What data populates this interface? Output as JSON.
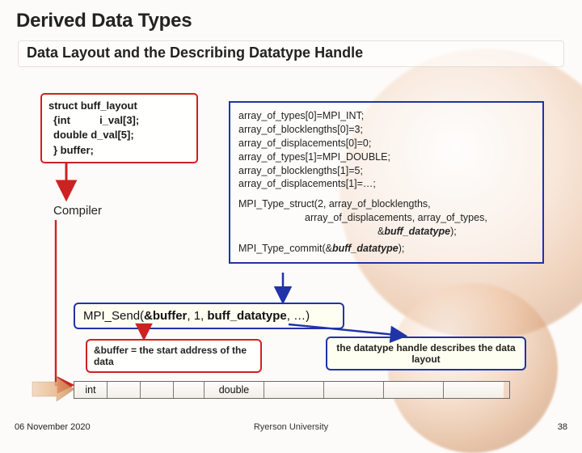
{
  "title": "Derived Data Types",
  "subtitle": "Data Layout and the Describing Datatype Handle",
  "struct": {
    "line1": "struct buff_layout",
    "line2_a": " {int",
    "line2_b": "i_val[3];",
    "line3": "  double d_val[5];",
    "line4": " } buffer;"
  },
  "compiler_label": "Compiler",
  "code": {
    "l1": "array_of_types[0]=MPI_INT;",
    "l2": "array_of_blocklengths[0]=3;",
    "l3": "array_of_displacements[0]=0;",
    "l4": "array_of_types[1]=MPI_DOUBLE;",
    "l5": "array_of_blocklengths[1]=5;",
    "l6": "array_of_displacements[1]=…;",
    "l7a": "MPI_Type_struct(2, array_of_blocklengths,",
    "l7b": "array_of_displacements, array_of_types,",
    "l7c_amp": "&",
    "l7c_arg": "buff_datatype",
    "l7c_tail": ");",
    "l8a": "MPI_Type_commit(&",
    "l8b": "buff_datatype",
    "l8c": ");"
  },
  "send": {
    "pre": "MPI_Send(",
    "arg1": "&buffer",
    "mid1": ", 1, ",
    "arg2": "buff_datatype",
    "tail": ", …)"
  },
  "buf_desc": "&buffer = the start address of the data",
  "handle_desc": "the datatype handle describes the data layout",
  "cells": {
    "int": "int",
    "double": "double"
  },
  "footer": {
    "date": "06 November 2020",
    "univ": "Ryerson University",
    "page": "38"
  }
}
